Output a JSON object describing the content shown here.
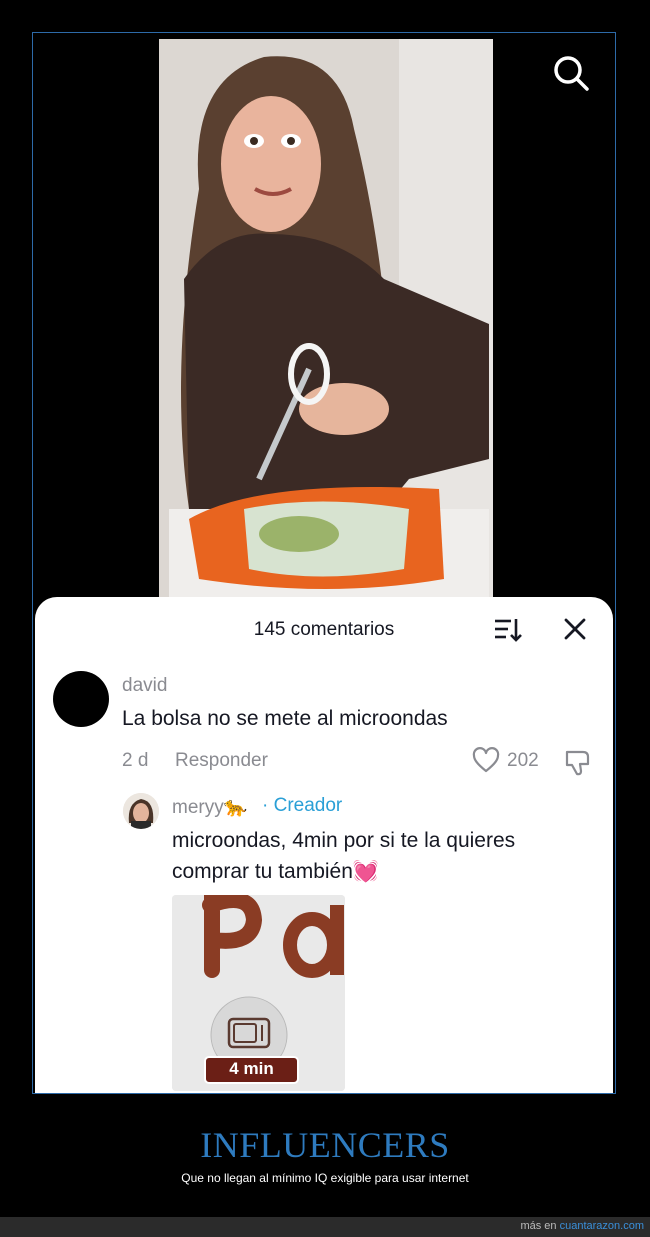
{
  "comments": {
    "count_label": "145 comentarios",
    "items": [
      {
        "user": "david",
        "text": "La bolsa no se mete al microondas",
        "age": "2 d",
        "reply_label": "Responder",
        "likes": "202"
      }
    ],
    "reply": {
      "user": "meryy🐆",
      "separator": " · ",
      "badge": "Creador",
      "text": "microondas, 4min por si te la quieres comprar tu también💓",
      "image_label": "4 min"
    }
  },
  "caption": {
    "title": "INFLUENCERS",
    "subtitle": "Que no llegan al mínimo IQ exigible para usar internet"
  },
  "footer": {
    "prefix": "más en",
    "site": "cuantarazon.com"
  },
  "icons": {
    "search": "search-icon",
    "sort": "sort-icon",
    "close": "close-icon",
    "like": "heart-icon",
    "dislike": "dislike-icon"
  },
  "colors": {
    "frame_border": "#2d6aa8",
    "creator_badge": "#2a9fd6",
    "caption_title": "#2e7bbf",
    "footer_link": "#3a8fd9"
  }
}
